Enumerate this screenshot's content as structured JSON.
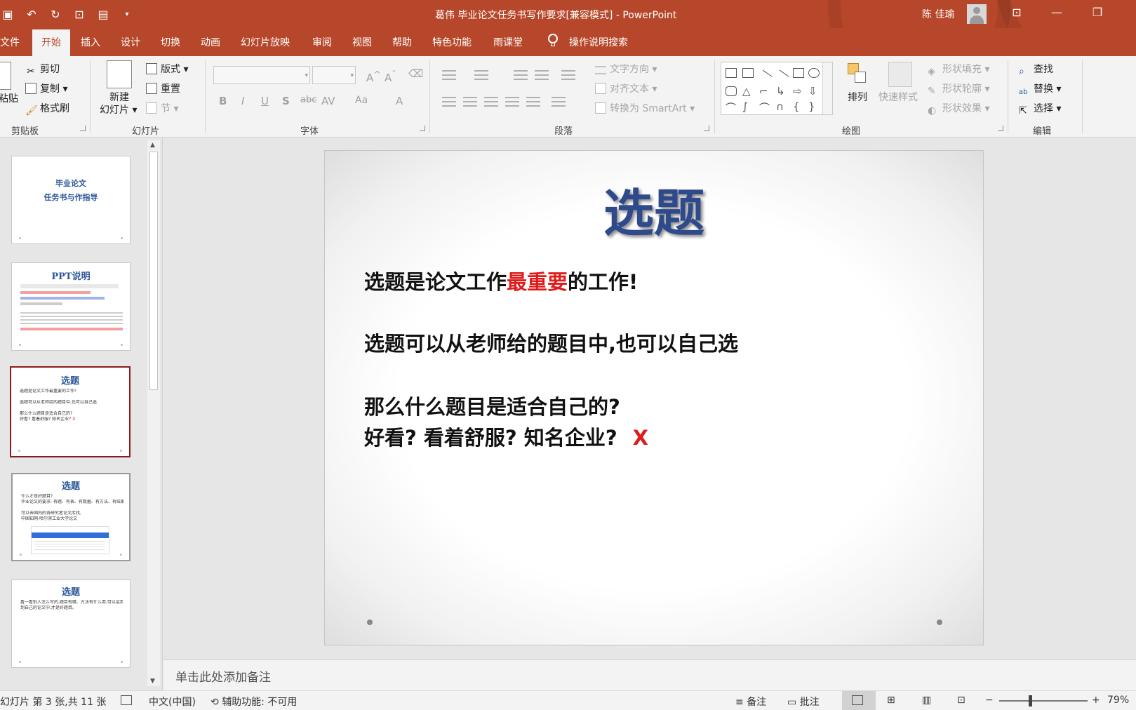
{
  "window": {
    "title": "葛伟 毕业论文任务书写作要求[兼容模式] - PowerPoint",
    "user": "陈 佳瑜"
  },
  "tabs": [
    "文件",
    "开始",
    "插入",
    "设计",
    "切换",
    "动画",
    "幻灯片放映",
    "审阅",
    "视图",
    "帮助",
    "特色功能",
    "雨课堂"
  ],
  "tell_me": "操作说明搜索",
  "ribbon": {
    "clipboard": {
      "paste": "粘贴",
      "cut": "剪切",
      "copy": "复制",
      "format_painter": "格式刷",
      "label": "剪贴板"
    },
    "slides": {
      "new_slide_1": "新建",
      "new_slide_2": "幻灯片",
      "layout": "版式",
      "reset": "重置",
      "section": "节",
      "label": "幻灯片"
    },
    "font": {
      "label": "字体",
      "bold": "B",
      "italic": "I",
      "underline": "U",
      "shadow": "S",
      "strike": "abc",
      "spacing": "AV",
      "case": "Aa",
      "color": "A"
    },
    "paragraph": {
      "text_direction": "文字方向",
      "align_text": "对齐文本",
      "smartart": "转换为 SmartArt",
      "label": "段落"
    },
    "drawing": {
      "arrange": "排列",
      "quick_styles": "快速样式",
      "fill": "形状填充",
      "outline": "形状轮廓",
      "effects": "形状效果",
      "label": "绘图"
    },
    "editing": {
      "find": "查找",
      "replace": "替换",
      "select": "选择",
      "label": "编辑"
    }
  },
  "thumbnails": [
    {
      "title_1": "毕业论文",
      "title_2": "任务书与作指导"
    },
    {
      "title": "PPT说明"
    },
    {
      "title": "选题",
      "lines": [
        "选题是论文工作最重要的工作!",
        "选题可以从老师给的题目中,也可以自己选",
        "那么什么题目是适合自己的?",
        "好看? 看着舒服? 知名企业?"
      ],
      "mark": "X"
    },
    {
      "title": "选题",
      "lines": [
        "什么才是好题目?",
        "毕业论文的要求: 有题、有表、有数据、有方法、有结果。",
        "可以去国内的各研究者论文库找,",
        "中国知网-哈尔滨工业大学论文"
      ]
    },
    {
      "title": "选题",
      "lines": [
        "看一看别人怎么写的,题目有哪、方法有什么用,可以运用",
        "到自己的论文中,才是好题目。"
      ]
    }
  ],
  "slide": {
    "title": "选题",
    "line1_a": "选题是论文工作",
    "line1_red": "最重要",
    "line1_b": "的工作!",
    "line2": "选题可以从老师给的题目中,也可以自己选",
    "line3": "那么什么题目是适合自己的?",
    "line4": "好看? 看着舒服? 知名企业?",
    "mark": "X"
  },
  "notes_placeholder": "单击此处添加备注",
  "status": {
    "slide_info": "幻灯片 第 3 张,共 11 张",
    "language": "中文(中国)",
    "accessibility": "辅助功能: 不可用",
    "notes": "备注",
    "comments": "批注",
    "zoom_minus": "−",
    "zoom_plus": "+",
    "zoom": "79%"
  },
  "colors": {
    "accent": "#b7472a",
    "slide_title": "#2e4a8a",
    "emphasis": "#e01b1b",
    "thumb_selected": "#8b1c1c"
  }
}
